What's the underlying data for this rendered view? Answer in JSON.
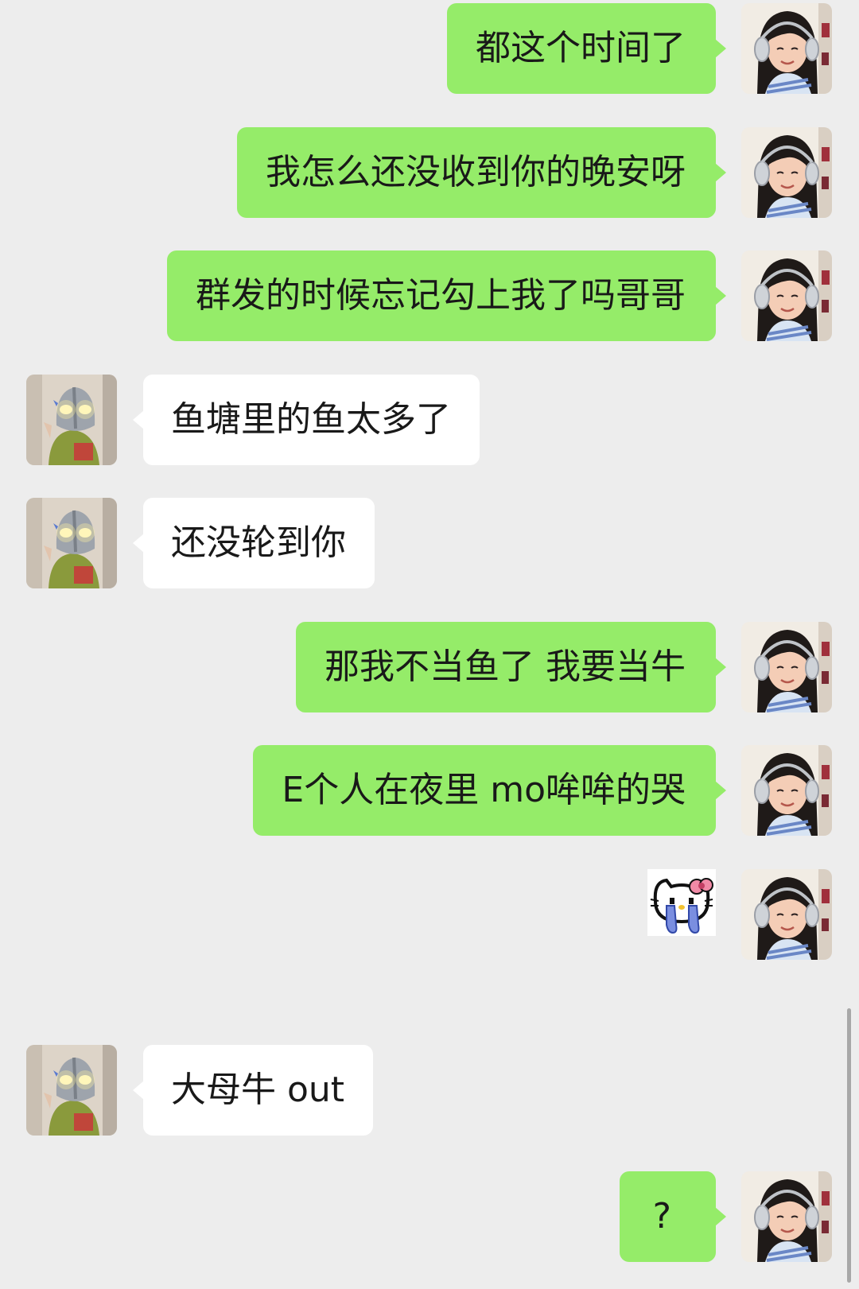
{
  "messages": [
    {
      "side": "right",
      "text": "都这个时间了",
      "sender": "self"
    },
    {
      "side": "right",
      "text": "我怎么还没收到你的晚安呀",
      "sender": "self"
    },
    {
      "side": "right",
      "text": "群发的时候忘记勾上我了吗哥哥",
      "sender": "self"
    },
    {
      "side": "left",
      "text": "鱼塘里的鱼太多了",
      "sender": "other"
    },
    {
      "side": "left",
      "text": "还没轮到你",
      "sender": "other"
    },
    {
      "side": "right",
      "text": "那我不当鱼了 我要当牛",
      "sender": "self"
    },
    {
      "side": "right",
      "text": "E个人在夜里 mo哞哞的哭",
      "sender": "self"
    },
    {
      "side": "right",
      "sticker": "hello-kitty-crying-sticker",
      "sender": "self"
    },
    {
      "side": "left",
      "text": "大母牛 out",
      "sender": "other"
    },
    {
      "side": "right",
      "text": "?",
      "sender": "self"
    }
  ],
  "colors": {
    "background": "#ededed",
    "self_bubble": "#95ec69",
    "other_bubble": "#ffffff",
    "text": "#191919"
  }
}
